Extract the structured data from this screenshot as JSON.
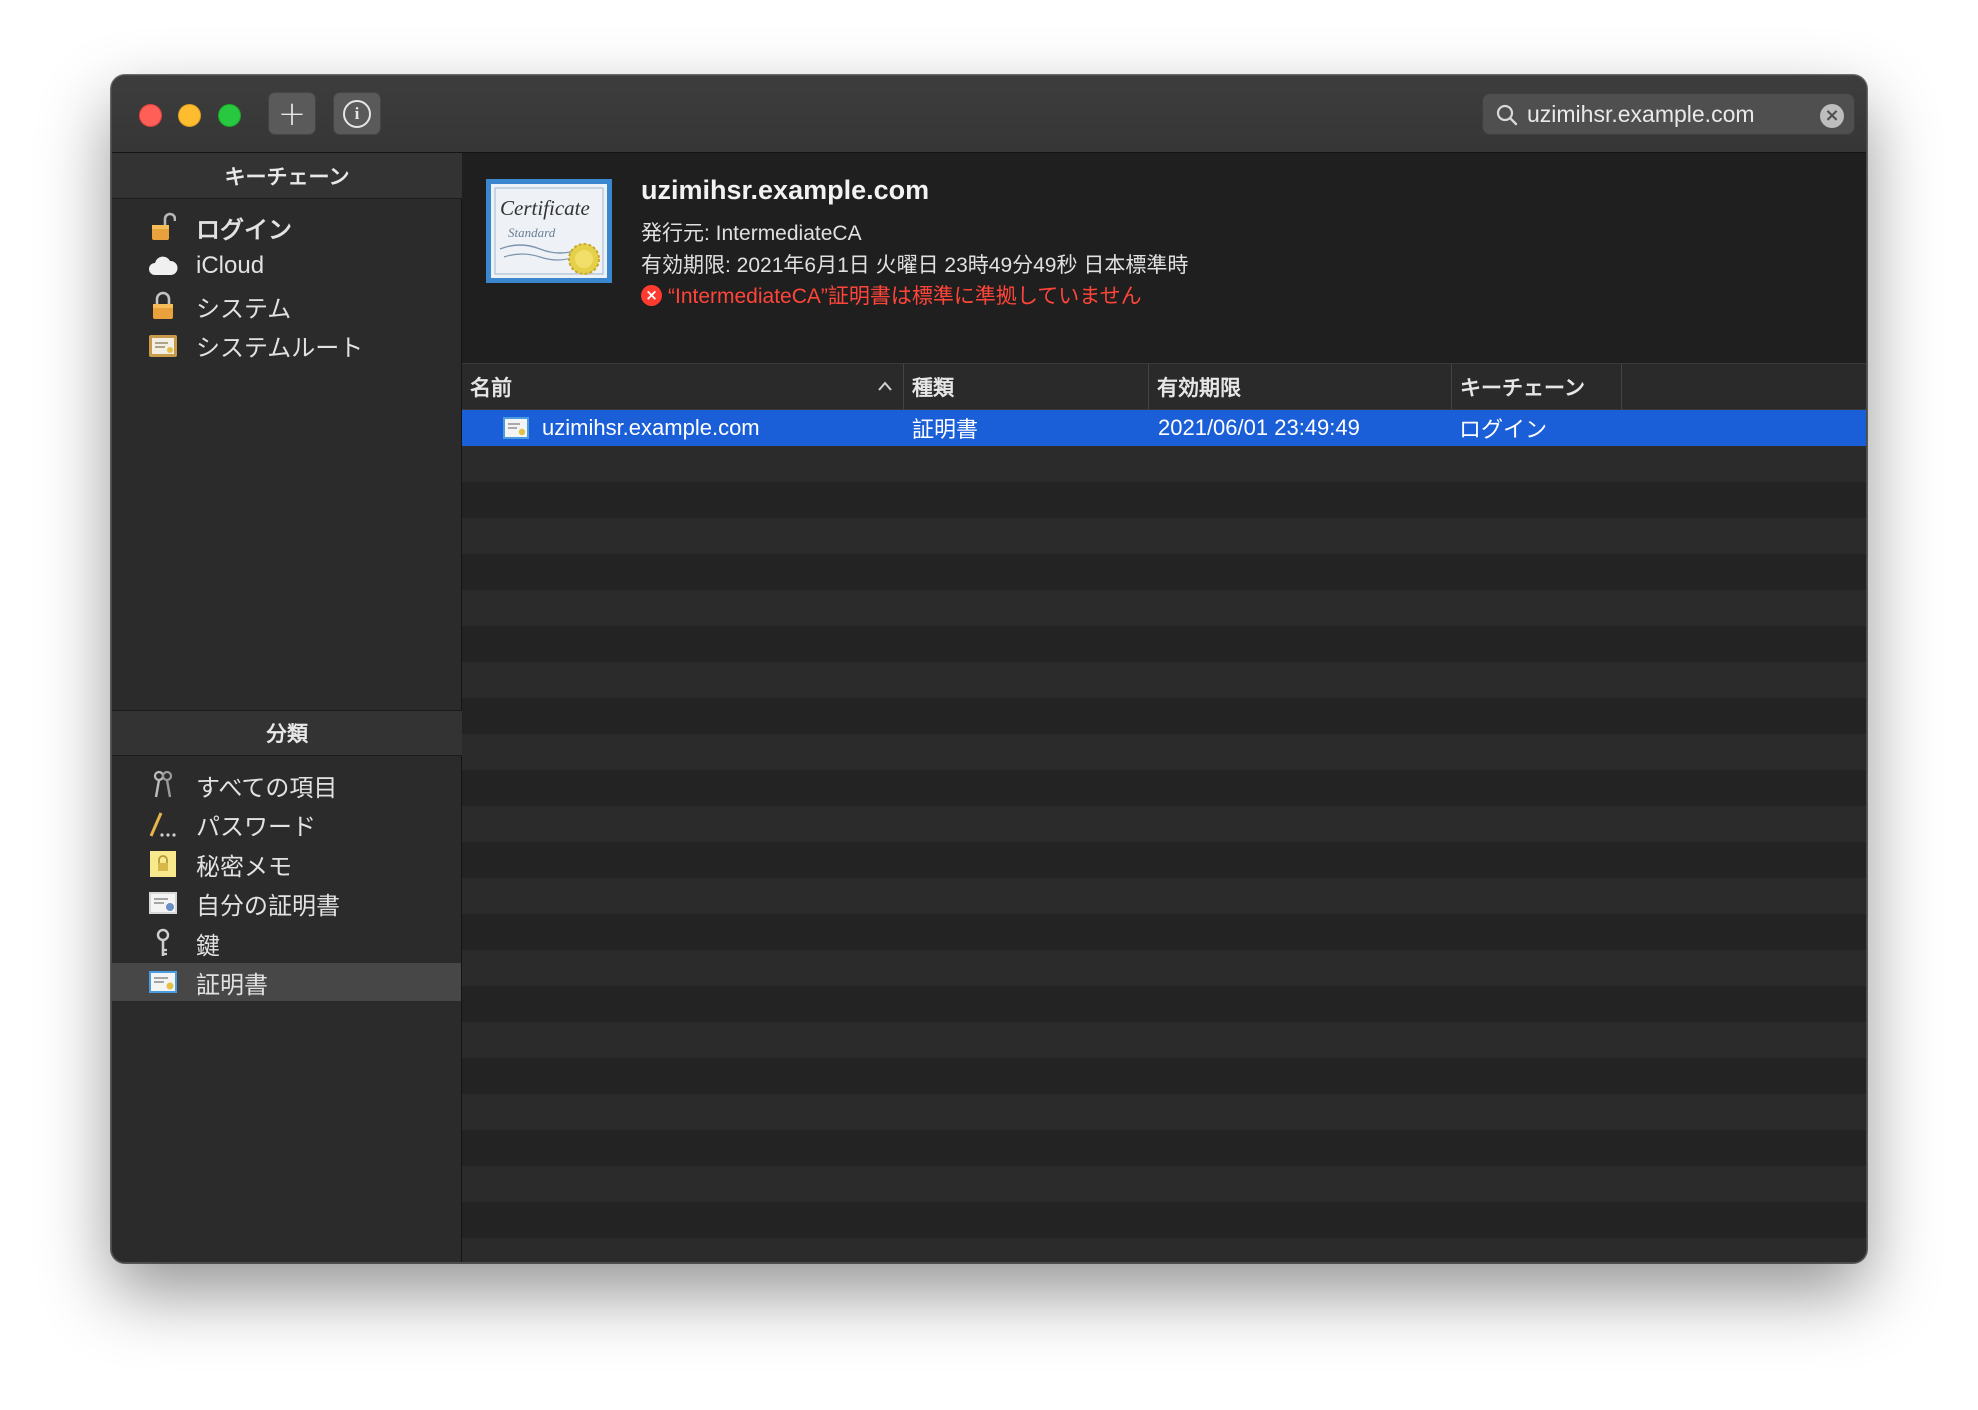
{
  "toolbar": {
    "search_value": "uzimihsr.example.com",
    "add_glyph": "+",
    "info_glyph": "i",
    "clear_glyph": "×"
  },
  "sidebar": {
    "keychains_header": "キーチェーン",
    "keychains": [
      {
        "label": "ログイン",
        "icon": "unlocked-padlock-icon"
      },
      {
        "label": "iCloud",
        "icon": "cloud-icon"
      },
      {
        "label": "システム",
        "icon": "padlock-icon"
      },
      {
        "label": "システムルート",
        "icon": "certificate-folder-icon"
      }
    ],
    "category_header": "分類",
    "categories": [
      {
        "label": "すべての項目",
        "icon": "keys-icon"
      },
      {
        "label": "パスワード",
        "icon": "password-pen-icon"
      },
      {
        "label": "秘密メモ",
        "icon": "secure-note-icon"
      },
      {
        "label": "自分の証明書",
        "icon": "my-certificate-icon"
      },
      {
        "label": "鍵",
        "icon": "key-icon"
      },
      {
        "label": "証明書",
        "icon": "certificate-icon"
      }
    ]
  },
  "detail": {
    "title": "uzimihsr.example.com",
    "issuer": "発行元: IntermediateCA",
    "expiry": "有効期限: 2021年6月1日 火曜日 23時49分49秒 日本標準時",
    "warning": "“IntermediateCA”証明書は標準に準拠していません",
    "cert_image_text_1": "Certificate",
    "cert_image_text_2": "Standard"
  },
  "table": {
    "columns": [
      "名前",
      "種類",
      "有効期限",
      "キーチェーン"
    ],
    "rows": [
      {
        "name": "uzimihsr.example.com",
        "kind": "証明書",
        "expires": "2021/06/01 23:49:49",
        "keychain": "ログイン"
      }
    ]
  },
  "colors": {
    "selection": "#1b5fd8",
    "warning": "#ff453a",
    "close": "#ff5f57",
    "minimize": "#febc2e",
    "maximize": "#28c840"
  }
}
